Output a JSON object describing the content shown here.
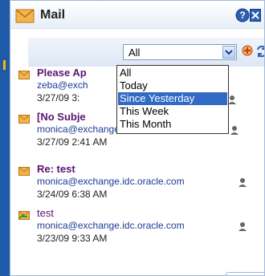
{
  "portlet": {
    "title": "Mail",
    "help_icon": "help-icon",
    "close_icon": "close-icon"
  },
  "filter": {
    "selected": "All",
    "options": [
      "All",
      "Today",
      "Since Yesterday",
      "This Week",
      "This Month"
    ],
    "highlighted_option": "Since Yesterday"
  },
  "messages": [
    {
      "subject": "Please Ap",
      "sender": "zeba@exch",
      "date": "3/27/09 3:",
      "icon": "envelope-icon",
      "bold": true
    },
    {
      "subject": "[No Subje",
      "sender": "monica@exchange.idc.oracle.com",
      "date": "3/27/09 2:41 AM",
      "icon": "envelope-icon",
      "bold": true
    },
    {
      "subject": "Re: test",
      "sender": "monica@exchange.idc.oracle.com",
      "date": "3/24/09 6:38 AM",
      "icon": "envelope-icon",
      "bold": true
    },
    {
      "subject": "test",
      "sender": "monica@exchange.idc.oracle.com",
      "date": "3/23/09 9:33 AM",
      "icon": "envelope-reply-icon",
      "bold": false
    }
  ],
  "colors": {
    "subject": "#5a1470",
    "sender": "#1f3a93",
    "selection": "#316ac5",
    "frame": "#a0b8d8"
  }
}
